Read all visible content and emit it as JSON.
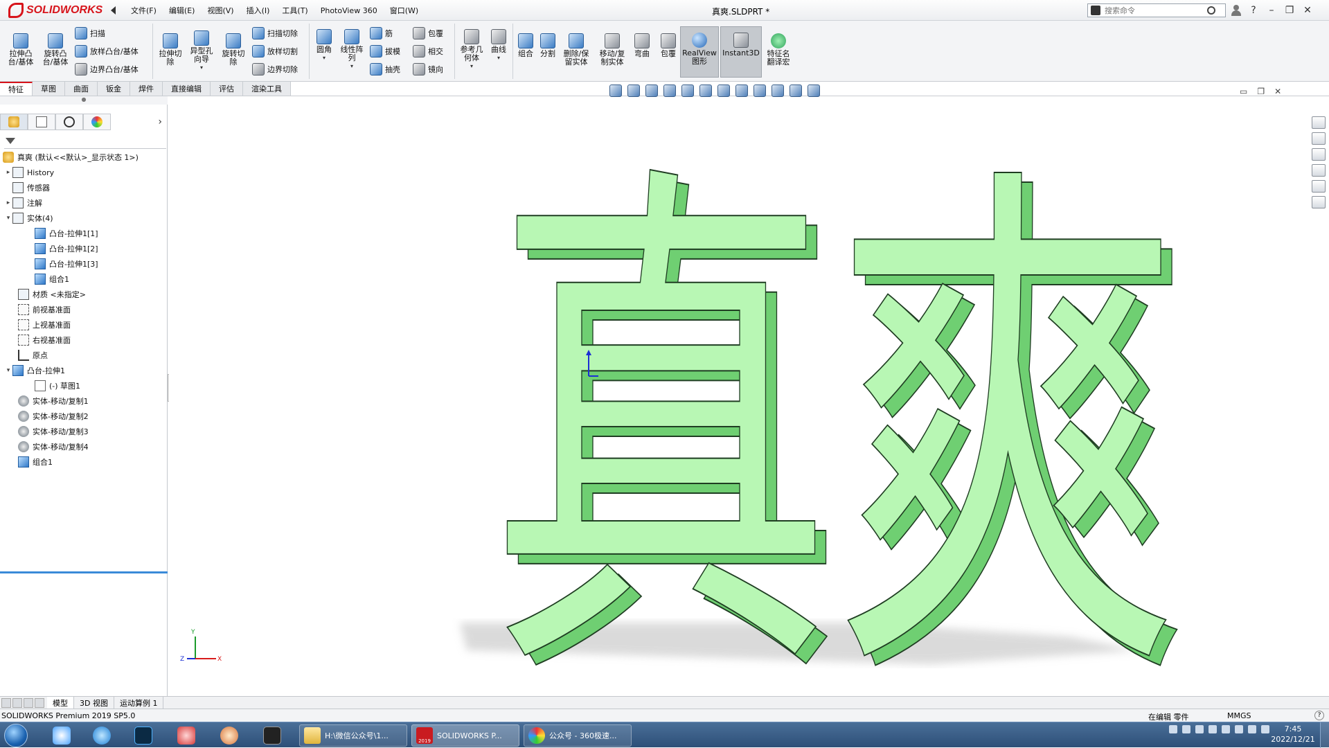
{
  "app": {
    "logo_text": "SOLIDWORKS",
    "doc_title": "真爽.SLDPRT *",
    "menus": [
      "文件(F)",
      "编辑(E)",
      "视图(V)",
      "插入(I)",
      "工具(T)",
      "PhotoView 360",
      "窗口(W)"
    ],
    "search_placeholder": "搜索命令",
    "help_label": "?",
    "minimize_label": "–",
    "restore_label": "❐",
    "close_label": "✕"
  },
  "ribbon": {
    "extrude_boss": "拉伸凸台/基体",
    "revolve_boss": "旋转凸台/基体",
    "sweep": "扫描",
    "loft": "放样凸台/基体",
    "boundary_boss": "边界凸台/基体",
    "extrude_cut": "拉伸切除",
    "hole_wizard": "异型孔向导",
    "revolve_cut": "旋转切除",
    "swept_cut": "扫描切除",
    "lofted_cut": "放样切割",
    "boundary_cut": "边界切除",
    "fillet": "圆角",
    "linear_pattern": "线性阵列",
    "rib": "筋",
    "draft": "拔模",
    "shell": "抽壳",
    "wrap": "包覆",
    "intersect": "相交",
    "mirror": "镜向",
    "ref_geometry": "参考几何体",
    "curves": "曲线",
    "combine": "组合",
    "split": "分割",
    "delete_keep": "删除/保留实体",
    "move_copy": "移动/复制实体",
    "flex": "弯曲",
    "wrap2": "包覆",
    "realview": "RealView图形",
    "instant3d": "Instant3D",
    "feature_name_translate": "特征名翻译宏"
  },
  "tabs": [
    "特征",
    "草图",
    "曲面",
    "钣金",
    "焊件",
    "直接编辑",
    "评估",
    "渲染工具"
  ],
  "tree": {
    "root": "真爽 (默认<<默认>_显示状态 1>)",
    "history": "History",
    "sensors": "传感器",
    "annotations": "注解",
    "solid_bodies": "实体(4)",
    "body1": "凸台-拉伸1[1]",
    "body2": "凸台-拉伸1[2]",
    "body3": "凸台-拉伸1[3]",
    "body4": "组合1",
    "material": "材质 <未指定>",
    "front_plane": "前视基准面",
    "top_plane": "上视基准面",
    "right_plane": "右视基准面",
    "origin": "原点",
    "boss_extrude": "凸台-拉伸1",
    "sketch": "(-) 草图1",
    "move1": "实体-移动/复制1",
    "move2": "实体-移动/复制2",
    "move3": "实体-移动/复制3",
    "move4": "实体-移动/复制4",
    "combine1": "组合1"
  },
  "model": {
    "text": "真爽",
    "color_face": "#b8f7b4",
    "color_side": "#6fcf72",
    "color_edge": "#1f3d22"
  },
  "triad": {
    "x": "X",
    "y": "Y",
    "z": "Z"
  },
  "bottom_tabs": [
    "模型",
    "3D 视图",
    "运动算例 1"
  ],
  "status": {
    "product": "SOLIDWORKS Premium 2019 SP5.0",
    "editing": "在编辑 零件",
    "units": "MMGS"
  },
  "taskbar": {
    "task_explorer": "H:\\微信公众号\\1...",
    "task_solidworks": "SOLIDWORKS P...",
    "task_browser": "公众号 - 360极速...",
    "sw_badge": "2019",
    "time": "7:45",
    "date": "2022/12/21"
  }
}
